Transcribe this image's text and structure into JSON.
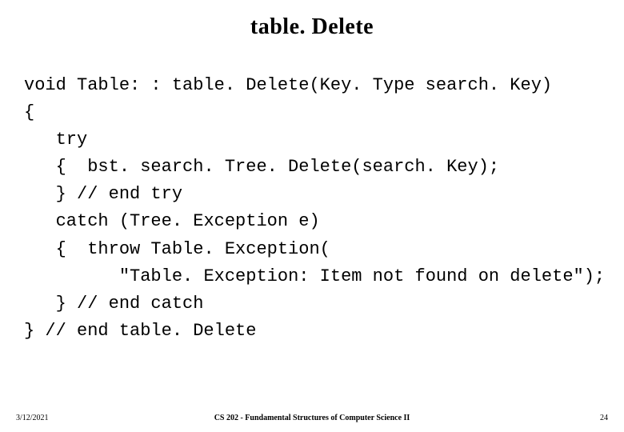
{
  "title": "table. Delete",
  "code": "void Table: : table. Delete(Key. Type search. Key)\n{\n   try\n   {  bst. search. Tree. Delete(search. Key);\n   } // end try\n   catch (Tree. Exception e)\n   {  throw Table. Exception(\n         \"Table. Exception: Item not found on delete\");\n   } // end catch\n} // end table. Delete",
  "footer": {
    "left": "3/12/2021",
    "center": "CS 202 - Fundamental Structures of Computer Science II",
    "right": "24"
  }
}
